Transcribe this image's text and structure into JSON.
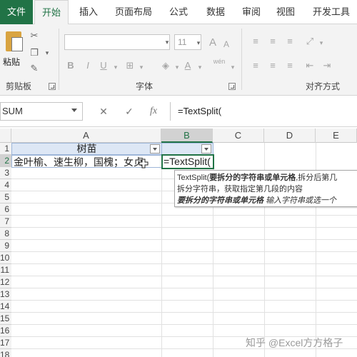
{
  "ribbon_tabs": [
    "文件",
    "开始",
    "插入",
    "页面布局",
    "公式",
    "数据",
    "审阅",
    "视图",
    "开发工具"
  ],
  "ribbon": {
    "paste_label": "粘贴",
    "clipboard_label": "剪贴板",
    "font_label": "字体",
    "alignment_label": "对齐方式",
    "font_size": "11",
    "bold": "B",
    "italic": "I",
    "underline": "U",
    "grow_font": "A",
    "shrink_font": "A",
    "phonetic": "wén"
  },
  "formula_bar": {
    "name_box": "SUM",
    "cancel": "✕",
    "enter": "✓",
    "fx": "fx",
    "content": "=TextSplit("
  },
  "grid": {
    "columns": [
      "A",
      "B",
      "C",
      "D",
      "E"
    ],
    "rows": [
      "1",
      "2",
      "3",
      "4",
      "5",
      "6",
      "7",
      "8",
      "9",
      "10",
      "11",
      "12",
      "13",
      "14",
      "15",
      "16",
      "17",
      "18"
    ],
    "a1": "树苗",
    "a2": "金叶榆、速生柳，国槐；女贞",
    "b2": "=TextSplit("
  },
  "tooltip": {
    "func": "TextSplit(",
    "arg1": "要拆分的字符串或单元格",
    "rest1": ",拆分后第几",
    "line2": "拆分字符串，获取指定第几段的内容",
    "arg1_desc": "要拆分的字符串或单元格",
    "arg1_hint": "输入字符串或选一个"
  },
  "watermark": "知乎 @Excel方方格子",
  "colors": {
    "file_tab": "#217346",
    "accent": "#217346",
    "header_cell": "#dde7f5"
  }
}
